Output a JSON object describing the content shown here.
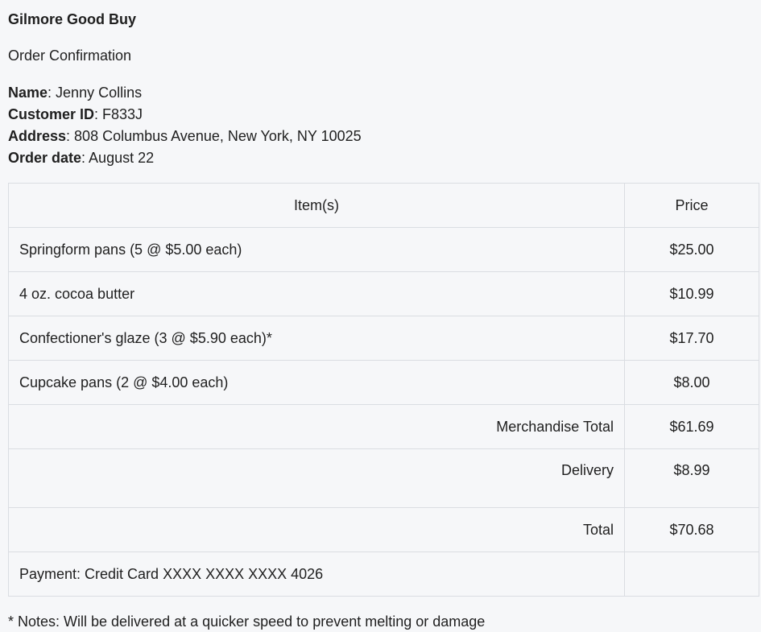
{
  "store": {
    "name": "Gilmore Good Buy"
  },
  "document": {
    "title": "Order Confirmation"
  },
  "customer": {
    "name_label": "Name",
    "name": "Jenny Collins",
    "id_label": "Customer ID",
    "id": "F833J",
    "address_label": "Address",
    "address": "808 Columbus Avenue, New York, NY 10025",
    "order_date_label": "Order date",
    "order_date": "August 22"
  },
  "table": {
    "headers": {
      "items": "Item(s)",
      "price": "Price"
    },
    "items": [
      {
        "description": "Springform pans (5 @ $5.00 each)",
        "price": "$25.00"
      },
      {
        "description": "4 oz. cocoa butter",
        "price": "$10.99"
      },
      {
        "description": "Confectioner's glaze (3 @ $5.90 each)*",
        "price": "$17.70"
      },
      {
        "description": "Cupcake pans (2 @ $4.00 each)",
        "price": "$8.00"
      }
    ],
    "merchandise_total_label": "Merchandise Total",
    "merchandise_total": "$61.69",
    "delivery_label": "Delivery",
    "delivery": "$8.99",
    "total_label": "Total",
    "total": "$70.68",
    "payment": "Payment: Credit Card XXXX XXXX XXXX 4026"
  },
  "note": "* Notes: Will be delivered at a quicker speed to prevent melting or damage"
}
